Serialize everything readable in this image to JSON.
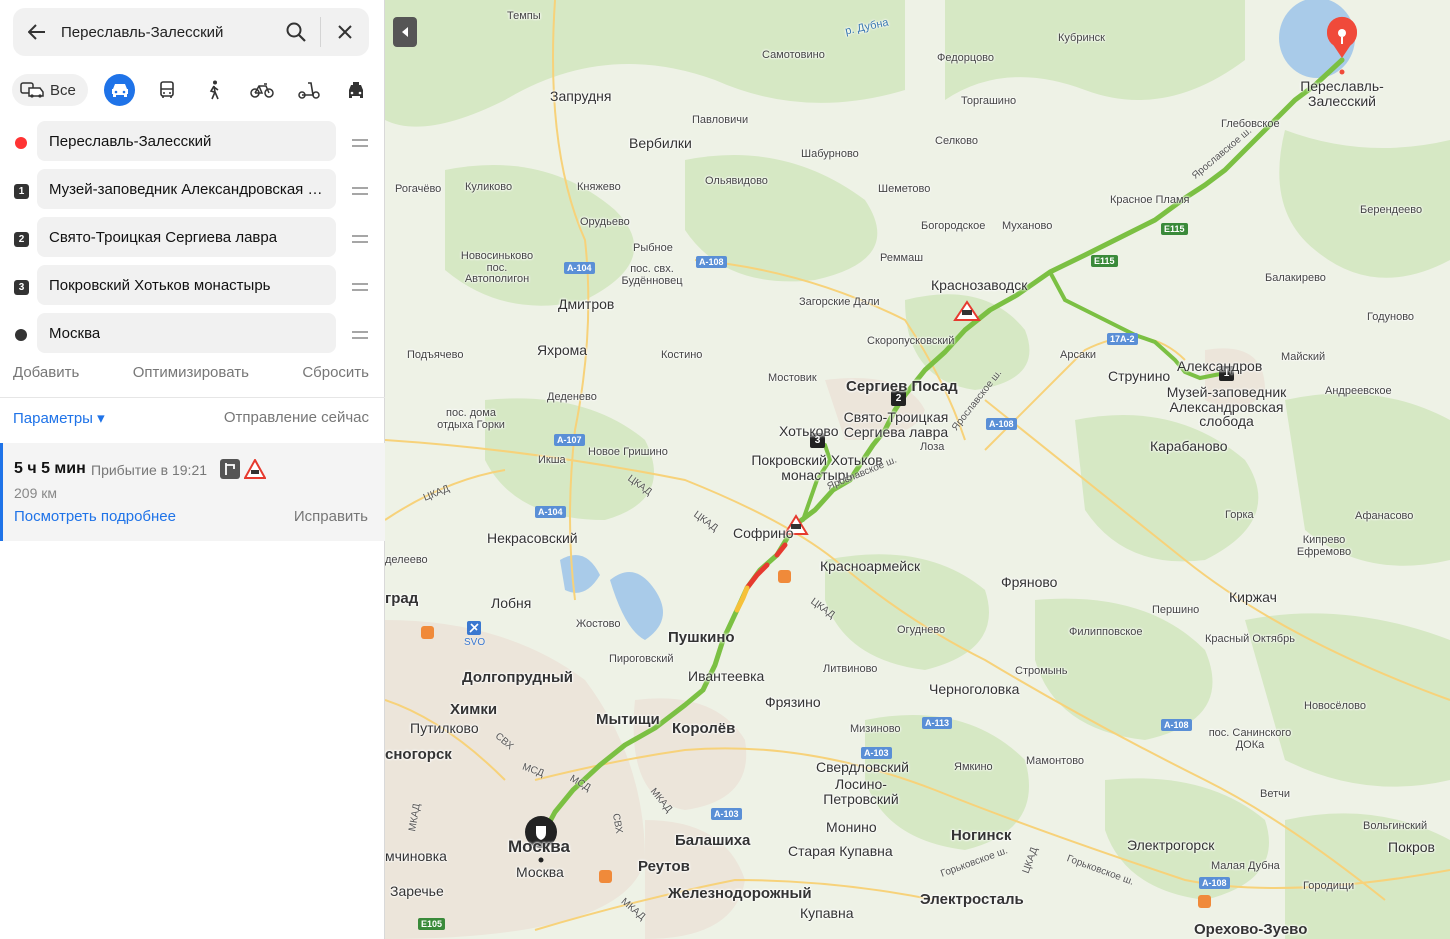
{
  "search": {
    "query": "Переславль-Залесский"
  },
  "modes": {
    "all_label": "Все",
    "items": [
      "car-icon",
      "bus-icon",
      "walk-icon",
      "bike-icon",
      "scooter-icon",
      "taxi-icon"
    ],
    "active": "car-icon"
  },
  "waypoints": [
    {
      "marker": "A",
      "label": "Переславль-Залесский",
      "color": "#f33"
    },
    {
      "marker": "1",
      "label": "Музей-заповедник Александровская с..."
    },
    {
      "marker": "2",
      "label": "Свято-Троицкая Сергиева лавра"
    },
    {
      "marker": "3",
      "label": "Покровский Хотьков монастырь"
    },
    {
      "marker": "B",
      "label": "Москва",
      "color": "#333"
    }
  ],
  "actions": {
    "add": "Добавить",
    "optimize": "Оптимизировать",
    "reset": "Сбросить"
  },
  "params": {
    "label": "Параметры ▾",
    "departure": "Отправление сейчас"
  },
  "route": {
    "duration": "5 ч 5 мин",
    "arrival": "Прибытие в 19:21",
    "distance": "209 км",
    "details": "Посмотреть подробнее",
    "fix": "Исправить"
  },
  "map": {
    "colors": {
      "route": "#7bc043",
      "jam": "#e63a2f",
      "slow": "#f6c13a",
      "pin": "#f04a3a"
    },
    "places": {
      "temply": "Темпы",
      "d_dubna": "р. Дубна",
      "kubrinsk": "Кубринск",
      "samotovino": "Самотовино",
      "fedortsovo": "Федорцово",
      "pereslavl": "Переславль-\nЗалесский",
      "zaprudnya": "Запрудня",
      "torgashino": "Торгашино",
      "pavlovichi": "Павловичи",
      "verbilki": "Вербилки",
      "selkovo": "Селково",
      "glebovskoe": "Глебовское",
      "shaburnovo": "Шабурново",
      "rogachevo": "Рогачёво",
      "kulikovo": "Куликово",
      "knyazhevo": "Княжево",
      "olyavidovo": "Ольявидово",
      "shemetovo": "Шеметово",
      "krasnoe_plamya": "Красное Пламя",
      "berendeevo": "Берендеево",
      "orudevo": "Орудьево",
      "bogorodskoe": "Богородское",
      "mukhanovo": "Муханово",
      "novosinkovo": "Новосиньково\nпос.\nАвтополигон",
      "rybnoe": "Рыбное",
      "budennovets": "пос. свх.\nБудённовец",
      "remmash": "Реммаш",
      "krasnozavodsk": "Краснозаводск",
      "balakirevo": "Балакирево",
      "dmitrov": "Дмитров",
      "zagorskie_dali": "Загорские Дали",
      "godunovo": "Годуново",
      "skoropuskovsky": "Скоропусковский",
      "podyachevo": "Подъячево",
      "yakhroma": "Яхрома",
      "kostino": "Костино",
      "arsaki": "Арсаки",
      "strunino": "Струнино",
      "aleksandrov": "Александров",
      "maysky": "Майский",
      "mostovik": "Мостовик",
      "sergiev_posad": "Сергиев Посад",
      "museum": "Музей-заповедник\nАлександровская\nслобода",
      "andreevskoe": "Андреевское",
      "dedenevo": "Деденево",
      "dom_otdykha": "пос. дома\nотдыха Горки",
      "lavra": "Свято-Троицкая\nСергиева лавра",
      "khotkovo": "Хотьково",
      "karabanovo": "Карабаново",
      "iksha": "Икша",
      "novoe_grishino": "Новое Гришино",
      "loza": "Лоза",
      "pokrovsky": "Покровский Хотьков\nмонастырь",
      "nekrasovsky": "Некрасовский",
      "sofrino": "Софрино",
      "gorka": "Горка",
      "afanasovo": "Афанасово",
      "kiprevo": "Кипрево\nЕфремово",
      "deleevo": "делеево",
      "krasnoarmeysk": "Красноармейск",
      "fryanovo": "Фряново",
      "grad": "град",
      "lobnya": "Лобня",
      "kirzhach": "Киржач",
      "pershino": "Першино",
      "zhostovo": "Жостово",
      "ogudnevo": "Огуднево",
      "filippovskoe": "Филипповское",
      "krasny_oktyabr": "Красный Октябрь",
      "pushkino": "Пушкино",
      "pirogovsky": "Пироговский",
      "litvinovo": "Литвиново",
      "stromyn": "Стромынь",
      "dolgoprudny": "Долгопрудный",
      "ivanteevka": "Ивантеевка",
      "chernogolovka": "Черноголовка",
      "khimki": "Химки",
      "fryazino": "Фрязино",
      "novoselovo": "Новосёлово",
      "mytishchi": "Мытищи",
      "korolev": "Королёв",
      "putilkovo": "Путилково",
      "mizinovo": "Мизиново",
      "san_dokha": "пос. Санинского\nДОКа",
      "krasnogorsk": "сногорск",
      "sverdlovsky": "Свердловский",
      "yamkino": "Ямкино",
      "mamontovo": "Мамонтово",
      "losino": "Лосино-\nПетровский",
      "vetchi": "Ветчи",
      "monino": "Монино",
      "volginsky": "Вольгинский",
      "moskva_big": "Москва",
      "moskva": "Москва",
      "balashikha": "Балашиха",
      "noginsk": "Ногинск",
      "elektrogorsk": "Электрогорск",
      "pokrov": "Покров",
      "mchinovka": "мчиновка",
      "reutov": "Реутов",
      "staraya_kupavna": "Старая Купавна",
      "malaya_dubna": "Малая Дубна",
      "gorodishchi": "Городищи",
      "zarechye": "Заречье",
      "zheleznodorozhny": "Железнодорожный",
      "elektrostal": "Электросталь",
      "kupavna": "Купавна",
      "orekhovo": "Орехово-Зуево"
    },
    "roads": {
      "a104_1": "А-104",
      "a108_1": "А-108",
      "e115_1": "E115",
      "e115_2": "E115",
      "r17a2": "17А-2",
      "a108_2": "А-108",
      "a107": "А-107",
      "a104_2": "А-104",
      "a113": "А-113",
      "a103_1": "А-103",
      "a108_3": "А-108",
      "a103_2": "А-103",
      "a108_4": "А-108",
      "e105": "E105",
      "ckad1": "ЦКАД",
      "ckad2": "ЦКАД",
      "ckad3": "ЦКАД",
      "ckad4": "ЦКАД",
      "ckad5": "ЦКАД",
      "yar1": "Ярославское ш.",
      "yar2": "Ярославское ш.",
      "yar3": "Ярославское ш.",
      "svkh": "СВХ",
      "mkad1": "МКАД",
      "mkad2": "МКАД",
      "mkad3": "МКАД",
      "msd": "МСД",
      "gork1": "Горьковское ш.",
      "gork2": "Горьковское ш.",
      "svo": "SVO",
      "msd2": "МСД"
    },
    "pins": {
      "p1": "1",
      "p2": "2",
      "p3": "3"
    }
  }
}
